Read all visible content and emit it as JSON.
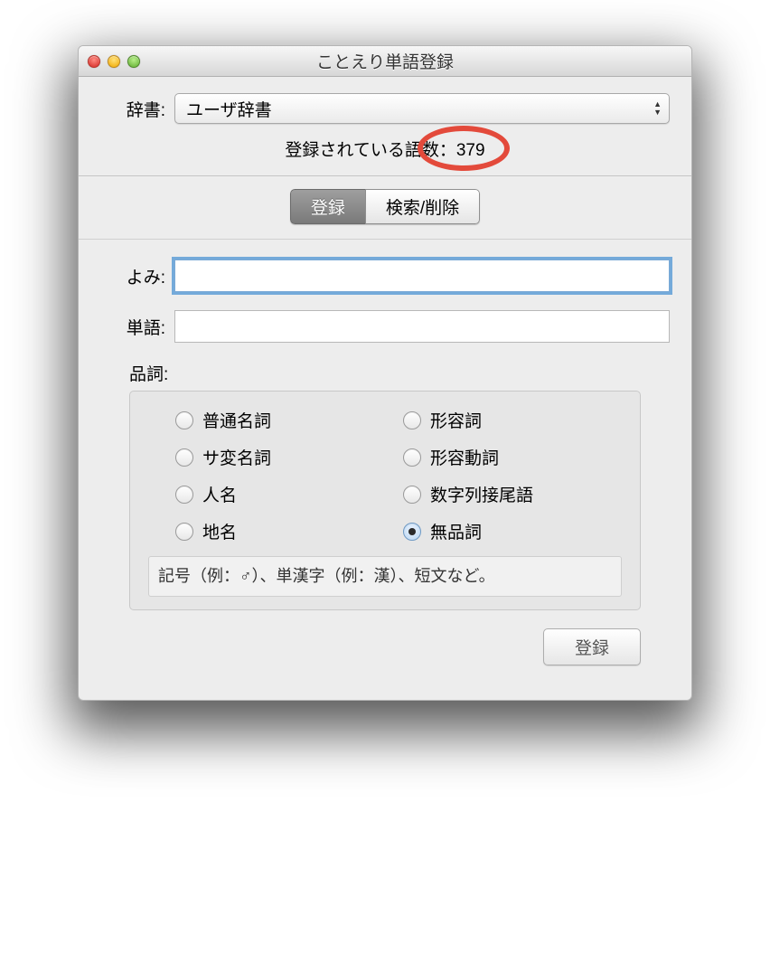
{
  "window": {
    "title": "ことえり単語登録"
  },
  "dictionary": {
    "label": "辞書:",
    "selected": "ユーザ辞書"
  },
  "count": {
    "label": "登録されている語数：",
    "value": "379"
  },
  "tabs": {
    "register": "登録",
    "search_delete": "検索/削除"
  },
  "fields": {
    "yomi_label": "よみ:",
    "yomi_value": "",
    "tango_label": "単語:",
    "tango_value": ""
  },
  "hinshi": {
    "label": "品詞:",
    "options": {
      "futsuu": "普通名詞",
      "keiyoushi": "形容詞",
      "sahen": "サ変名詞",
      "keiyoudoushi": "形容動詞",
      "jinmei": "人名",
      "suujiretsu": "数字列接尾語",
      "chimei": "地名",
      "muhinshi": "無品詞"
    },
    "help": "記号（例：♂）、単漢字（例：漢）、短文など。"
  },
  "buttons": {
    "register": "登録"
  }
}
